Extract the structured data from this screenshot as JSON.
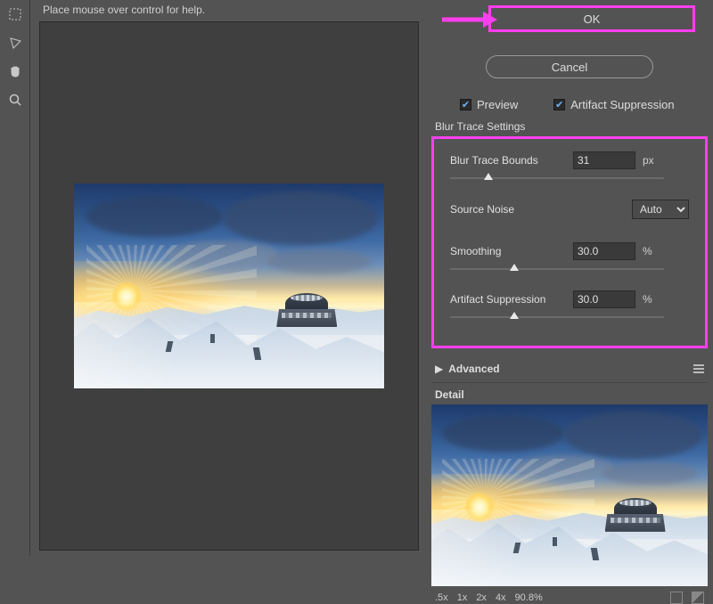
{
  "help_text": "Place mouse over control for help.",
  "buttons": {
    "ok": "OK",
    "cancel": "Cancel"
  },
  "checks": {
    "preview": "Preview",
    "artifact": "Artifact Suppression"
  },
  "section_blur": "Blur Trace Settings",
  "controls": {
    "bounds_label": "Blur Trace Bounds",
    "bounds_value": "31",
    "bounds_unit": "px",
    "noise_label": "Source Noise",
    "noise_value": "Auto",
    "smoothing_label": "Smoothing",
    "smoothing_value": "30.0",
    "smoothing_unit": "%",
    "artifact_label": "Artifact Suppression",
    "artifact_value": "30.0",
    "artifact_unit": "%"
  },
  "advanced": "Advanced",
  "detail": "Detail",
  "zoom": {
    "z1": ".5x",
    "z2": "1x",
    "z3": "2x",
    "z4": "4x",
    "pct": "90.8%"
  }
}
